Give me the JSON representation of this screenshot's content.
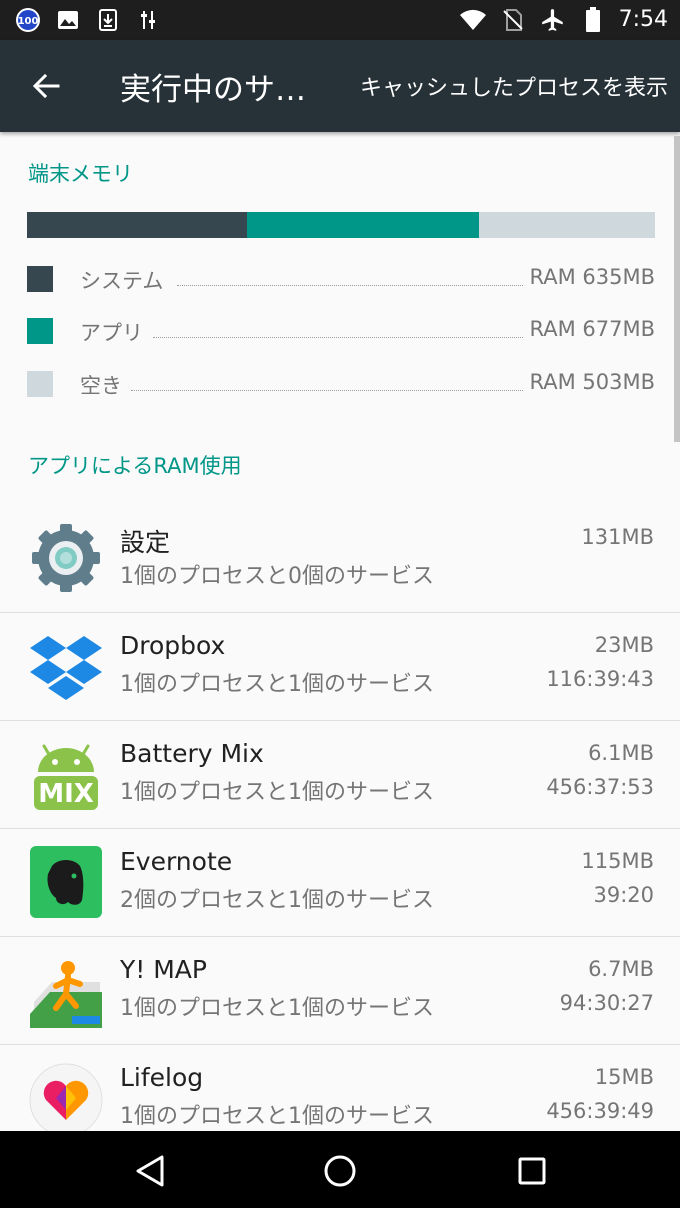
{
  "status_bar": {
    "battery_badge": "100",
    "time": "7:54",
    "icons": [
      "battery-100-badge-icon",
      "image-icon",
      "download-icon",
      "usb-settings-icon",
      "wifi-icon",
      "no-sim-icon",
      "airplane-mode-icon",
      "battery-icon"
    ]
  },
  "app_bar": {
    "title": "実行中のサ…",
    "action": "キャッシュしたプロセスを表示"
  },
  "memory": {
    "section_title": "端末メモリ",
    "bar": [
      {
        "fraction": 0.35,
        "color": "#37474f"
      },
      {
        "fraction": 0.37,
        "color": "#009688"
      },
      {
        "fraction": 0.28,
        "color": "#cfd8dc"
      }
    ],
    "legend": [
      {
        "label": "システム",
        "value": "RAM 635MB",
        "color": "#37474f"
      },
      {
        "label": "アプリ",
        "value": "RAM 677MB",
        "color": "#009688"
      },
      {
        "label": "空き",
        "value": "RAM 503MB",
        "color": "#cfd8dc"
      }
    ]
  },
  "apps_section_title": "アプリによるRAM使用",
  "apps": [
    {
      "name": "設定",
      "desc": "1個のプロセスと0個のサービス",
      "size": "131MB",
      "time": "",
      "icon": "settings-gear-icon"
    },
    {
      "name": "Dropbox",
      "desc": "1個のプロセスと1個のサービス",
      "size": "23MB",
      "time": "116:39:43",
      "icon": "dropbox-icon"
    },
    {
      "name": "Battery Mix",
      "desc": "1個のプロセスと1個のサービス",
      "size": "6.1MB",
      "time": "456:37:53",
      "icon": "battery-mix-icon",
      "icon_text": "MIX"
    },
    {
      "name": "Evernote",
      "desc": "2個のプロセスと1個のサービス",
      "size": "115MB",
      "time": "39:20",
      "icon": "evernote-icon"
    },
    {
      "name": "Y! MAP",
      "desc": "1個のプロセスと1個のサービス",
      "size": "6.7MB",
      "time": "94:30:27",
      "icon": "ymap-icon"
    },
    {
      "name": "Lifelog",
      "desc": "1個のプロセスと1個のサービス",
      "size": "15MB",
      "time": "456:39:49",
      "icon": "lifelog-icon"
    }
  ],
  "nav_bar": {
    "buttons": [
      "back-triangle-icon",
      "home-circle-icon",
      "recents-square-icon"
    ]
  },
  "colors": {
    "accent": "#009688",
    "app_bar": "#263238",
    "status_bar": "#1e1e1e"
  }
}
